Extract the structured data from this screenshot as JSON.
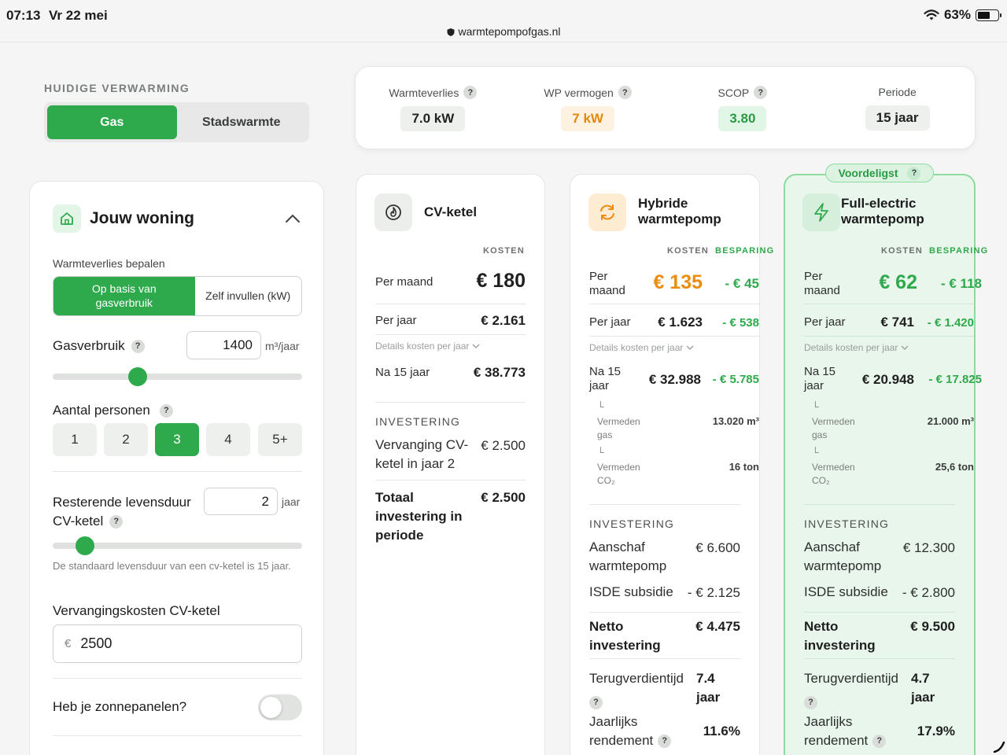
{
  "status": {
    "time": "07:13",
    "date": "Vr 22 mei",
    "url": "warmtepompofgas.nl",
    "battery": "63%"
  },
  "heating": {
    "label": "HUIDIGE VERWARMING",
    "options": [
      "Gas",
      "Stadswarmte"
    ],
    "selected": "Gas"
  },
  "metrics": [
    {
      "label": "Warmteverlies",
      "value": "7.0 kW",
      "help": "?"
    },
    {
      "label": "WP vermogen",
      "value": "7 kW",
      "help": "?"
    },
    {
      "label": "SCOP",
      "value": "3.80",
      "help": "?"
    },
    {
      "label": "Periode",
      "value": "15 jaar"
    }
  ],
  "woning": {
    "title": "Jouw woning",
    "method_label": "Warmteverlies bepalen",
    "method_options": [
      "Op basis van gasverbruik",
      "Zelf invullen (kW)"
    ],
    "gas_label": "Gasverbruik",
    "gas_value": "1400",
    "gas_unit": "m³/jaar",
    "gas_slider_fraction": 0.34,
    "persons_label": "Aantal personen",
    "persons": [
      "1",
      "2",
      "3",
      "4",
      "5+"
    ],
    "persons_selected": "3",
    "life_label_1": "Resterende levensduur",
    "life_label_2": "CV-ketel",
    "life_value": "2",
    "life_unit": "jaar",
    "life_slider_fraction": 0.13,
    "life_hint": "De standaard levensduur van een cv-ketel is 15 jaar.",
    "replace_label": "Vervangingskosten CV-ketel",
    "replace_currency": "€",
    "replace_value": "2500",
    "solar_label": "Heb je zonnepanelen?",
    "help": "?"
  },
  "cards": {
    "header_costs": "KOSTEN",
    "header_savings": "BESPARING",
    "details_label": "Details kosten per jaar",
    "invest_header": "INVESTERING",
    "recommended": "Voordeligst",
    "cv": {
      "title": "CV-ketel",
      "per_month_label": "Per maand",
      "per_month": "€ 180",
      "per_year_label": "Per jaar",
      "per_year": "€ 2.161",
      "after_label": "Na 15 jaar",
      "after": "€ 38.773",
      "inv_label_1": "Vervanging CV-",
      "inv_label_2": "ketel in jaar 2",
      "inv_value": "€ 2.500",
      "total_label_1": "Totaal",
      "total_label_2": "investering in",
      "total_label_3": "periode",
      "total_value": "€ 2.500"
    },
    "hybrid": {
      "title_1": "Hybride",
      "title_2": "warmtepomp",
      "per_month_label_1": "Per",
      "per_month_label_2": "maand",
      "per_month": "€ 135",
      "per_month_saving": "- € 45",
      "per_year_label": "Per jaar",
      "per_year": "€ 1.623",
      "per_year_saving": "- € 538",
      "after_label_1": "Na 15",
      "after_label_2": "jaar",
      "after": "€ 32.988",
      "after_saving": "- € 5.785",
      "gas_label_1": "Vermeden",
      "gas_label_2": "gas",
      "gas_value": "13.020 m³",
      "co2_label_1": "Vermeden",
      "co2_label_2": "CO₂",
      "co2_value": "16 ton",
      "buy_label_1": "Aanschaf",
      "buy_label_2": "warmtepomp",
      "buy_value": "€ 6.600",
      "isde_label": "ISDE subsidie",
      "isde_value": "- € 2.125",
      "net_label_1": "Netto",
      "net_label_2": "investering",
      "net_value": "€ 4.475",
      "payback_label": "Terugverdientijd",
      "payback_value_1": "7.4",
      "payback_value_2": "jaar",
      "yield_label_1": "Jaarlijks",
      "yield_label_2": "rendement",
      "yield_value": "11.6%"
    },
    "full": {
      "title_1": "Full-electric",
      "title_2": "warmtepomp",
      "per_month_label_1": "Per",
      "per_month_label_2": "maand",
      "per_month": "€ 62",
      "per_month_saving": "- € 118",
      "per_year_label": "Per jaar",
      "per_year": "€ 741",
      "per_year_saving": "- € 1.420",
      "after_label_1": "Na 15",
      "after_label_2": "jaar",
      "after": "€ 20.948",
      "after_saving": "- € 17.825",
      "gas_label_1": "Vermeden",
      "gas_label_2": "gas",
      "gas_value": "21.000 m³",
      "co2_label_1": "Vermeden",
      "co2_label_2": "CO₂",
      "co2_value": "25,6 ton",
      "buy_label_1": "Aanschaf",
      "buy_label_2": "warmtepomp",
      "buy_value": "€ 12.300",
      "isde_label": "ISDE subsidie",
      "isde_value": "- € 2.800",
      "net_label_1": "Netto",
      "net_label_2": "investering",
      "net_value": "€ 9.500",
      "payback_label": "Terugverdientijd",
      "payback_value_1": "4.7",
      "payback_value_2": "jaar",
      "yield_label_1": "Jaarlijks",
      "yield_label_2": "rendement",
      "yield_value": "17.9%"
    }
  },
  "colors": {
    "accent": "#2ea94b",
    "orange": "#ec8c0f",
    "recommended_bg": "#e8f6ec"
  }
}
